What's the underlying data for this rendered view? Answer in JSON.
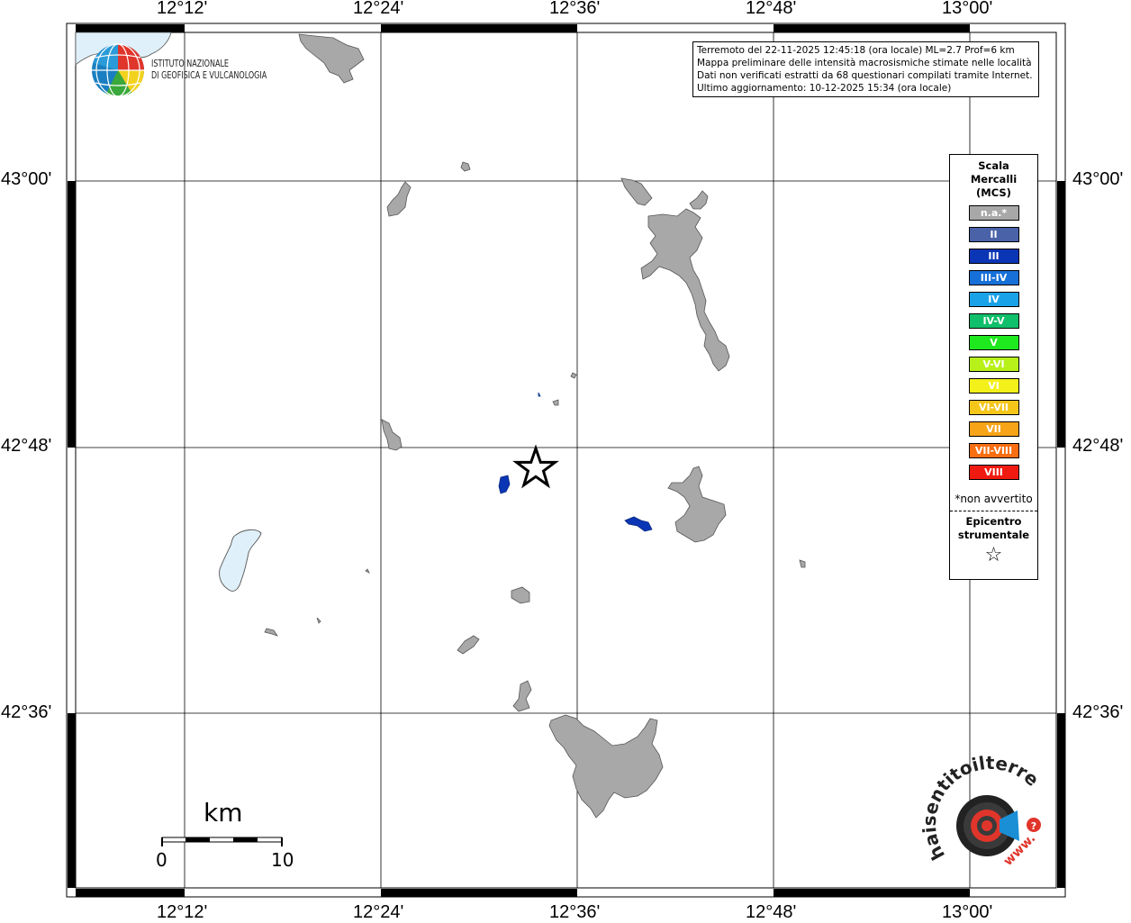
{
  "map": {
    "top_lon_labels": [
      "12°12'",
      "12°24'",
      "12°36'",
      "12°48'",
      "13°00'"
    ],
    "bottom_lon_labels": [
      "12°12'",
      "12°24'",
      "12°36'",
      "12°48'",
      "13°00'"
    ],
    "left_lat_labels": [
      "43°00'",
      "42°48'",
      "42°36'"
    ],
    "right_lat_labels": [
      "43°00'",
      "42°48'",
      "42°36'"
    ],
    "land_color": "#a8a8a8",
    "lake_color": "#dff0fa"
  },
  "info": {
    "line1": "Terremoto del 22-11-2025 12:45:18 (ora locale) ML=2.7 Prof=6 km",
    "line2": "Mappa preliminare delle intensità macrosismiche stimate nelle località",
    "line3": "Dati non verificati estratti da 68 questionari compilati tramite Internet.",
    "line4": "Ultimo aggiornamento: 10-12-2025 15:34 (ora locale)"
  },
  "logo": {
    "line1": "ISTITUTO NAZIONALE",
    "line2": "DI GEOFISICA E VULCANOLOGIA"
  },
  "legend": {
    "title1": "Scala",
    "title2": "Mercalli",
    "title3": "(MCS)",
    "items": [
      {
        "label": "n.a.*",
        "color": "#a8a8a8"
      },
      {
        "label": "II",
        "color": "#4a62a8"
      },
      {
        "label": "III",
        "color": "#0a35b5"
      },
      {
        "label": "III-IV",
        "color": "#1670d8"
      },
      {
        "label": "IV",
        "color": "#1aa2e8"
      },
      {
        "label": "IV-V",
        "color": "#0fbf6a"
      },
      {
        "label": "V",
        "color": "#1ee81e"
      },
      {
        "label": "V-VI",
        "color": "#b8f01a"
      },
      {
        "label": "VI",
        "color": "#f4f01a"
      },
      {
        "label": "VI-VII",
        "color": "#f4c61a"
      },
      {
        "label": "VII",
        "color": "#f8a418"
      },
      {
        "label": "VII-VIII",
        "color": "#f86e10"
      },
      {
        "label": "VIII",
        "color": "#f01a10"
      }
    ],
    "note": "*non avvertito",
    "epicenter1": "Epicentro",
    "epicenter2": "strumentale"
  },
  "scale": {
    "unit": "km",
    "left": "0",
    "right": "10"
  },
  "hsit": {
    "arc_text": "haisentitoilterremoto.it",
    "www": "www."
  }
}
